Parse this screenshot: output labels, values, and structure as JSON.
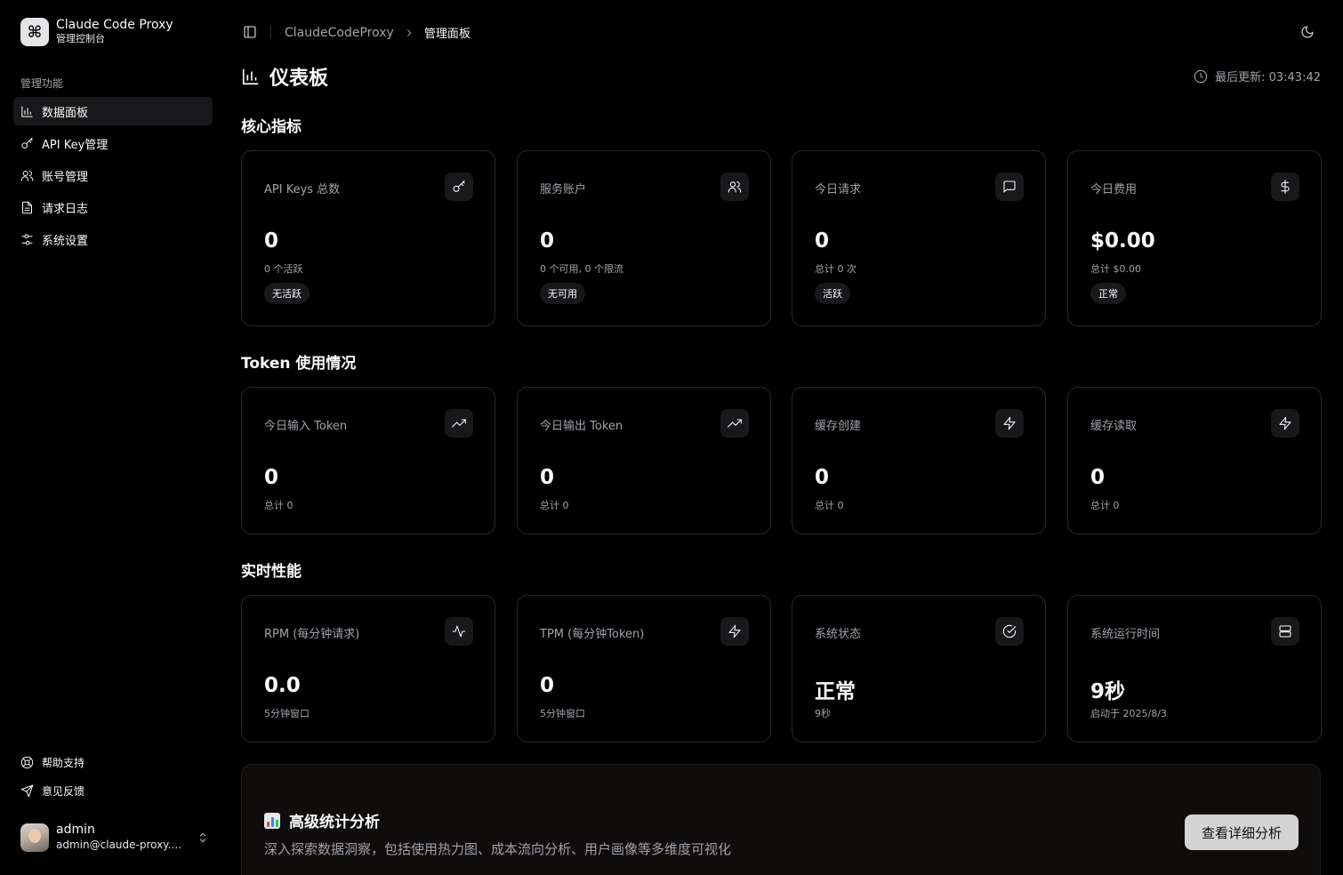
{
  "brand": {
    "logo_glyph": "⌘",
    "title": "Claude Code Proxy",
    "subtitle": "管理控制台"
  },
  "sidebar": {
    "group_label": "管理功能",
    "items": [
      {
        "label": "数据面板",
        "icon": "bar-chart-icon",
        "active": true
      },
      {
        "label": "API Key管理",
        "icon": "key-icon",
        "active": false
      },
      {
        "label": "账号管理",
        "icon": "users-icon",
        "active": false
      },
      {
        "label": "请求日志",
        "icon": "file-text-icon",
        "active": false
      },
      {
        "label": "系统设置",
        "icon": "sliders-icon",
        "active": false
      }
    ],
    "bottom_items": [
      {
        "label": "帮助支持",
        "icon": "life-buoy-icon"
      },
      {
        "label": "意见反馈",
        "icon": "send-icon"
      }
    ]
  },
  "user": {
    "name": "admin",
    "email": "admin@claude-proxy.com"
  },
  "header": {
    "breadcrumb": {
      "root": "ClaudeCodeProxy",
      "current": "管理面板"
    }
  },
  "page": {
    "title": "仪表板",
    "last_updated": "最后更新: 03:43:42"
  },
  "sections": {
    "core": "核心指标",
    "token": "Token 使用情况",
    "perf": "实时性能"
  },
  "core_cards": [
    {
      "label": "API Keys 总数",
      "icon": "key-icon",
      "value": "0",
      "sub": "0 个活跃",
      "badge": "无活跃"
    },
    {
      "label": "服务账户",
      "icon": "users-icon",
      "value": "0",
      "sub": "0 个可用, 0 个限流",
      "badge": "无可用"
    },
    {
      "label": "今日请求",
      "icon": "message-square-icon",
      "value": "0",
      "sub": "总计 0 次",
      "badge": "活跃"
    },
    {
      "label": "今日费用",
      "icon": "dollar-icon",
      "value": "$0.00",
      "sub": "总计 $0.00",
      "badge": "正常"
    }
  ],
  "token_cards": [
    {
      "label": "今日输入 Token",
      "icon": "trending-up-icon",
      "value": "0",
      "sub": "总计 0"
    },
    {
      "label": "今日输出 Token",
      "icon": "trending-up-icon",
      "value": "0",
      "sub": "总计 0"
    },
    {
      "label": "缓存创建",
      "icon": "zap-icon",
      "value": "0",
      "sub": "总计 0"
    },
    {
      "label": "缓存读取",
      "icon": "zap-icon",
      "value": "0",
      "sub": "总计 0"
    }
  ],
  "perf_cards": [
    {
      "label": "RPM (每分钟请求)",
      "icon": "activity-icon",
      "value": "0.0",
      "sub": "5分钟窗口"
    },
    {
      "label": "TPM (每分钟Token)",
      "icon": "zap-icon",
      "value": "0",
      "sub": "5分钟窗口"
    },
    {
      "label": "系统状态",
      "icon": "check-circle-icon",
      "value": "正常",
      "sub": "9秒"
    },
    {
      "label": "系统运行时间",
      "icon": "server-icon",
      "value": "9秒",
      "sub": "启动于 2025/8/3"
    }
  ],
  "banner": {
    "title": "高级统计分析",
    "description": "深入探索数据洞察，包括使用热力图、成本流向分析、用户画像等多维度可视化",
    "button": "查看详细分析"
  }
}
